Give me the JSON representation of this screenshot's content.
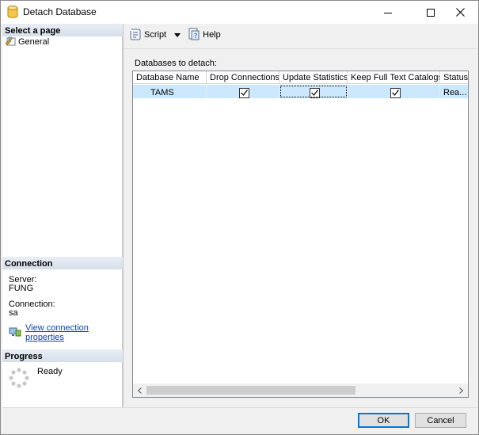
{
  "window": {
    "title": "Detach Database"
  },
  "left_panel": {
    "select_page_header": "Select a page",
    "pages": [
      {
        "label": "General",
        "icon": "wrench-page-icon"
      }
    ],
    "connection_header": "Connection",
    "server_label": "Server:",
    "server_value": "FUNG",
    "connection_label": "Connection:",
    "connection_value": "sa",
    "view_connection_link": "View connection properties",
    "progress_header": "Progress",
    "progress_status": "Ready"
  },
  "toolbar": {
    "script_label": "Script",
    "help_label": "Help"
  },
  "grid": {
    "caption": "Databases to detach:",
    "columns": [
      "Database Name",
      "Drop Connections",
      "Update Statistics",
      "Keep Full Text Catalogs",
      "Status"
    ],
    "rows": [
      {
        "database_name": "TAMS",
        "drop_connections": true,
        "update_statistics": true,
        "keep_full_text_catalogs": true,
        "status": "Rea..."
      }
    ]
  },
  "buttons": {
    "ok_label": "OK",
    "cancel_label": "Cancel"
  },
  "colors": {
    "selection_row": "#cce8ff",
    "link": "#0645ad",
    "default_button_border": "#0078d7"
  }
}
